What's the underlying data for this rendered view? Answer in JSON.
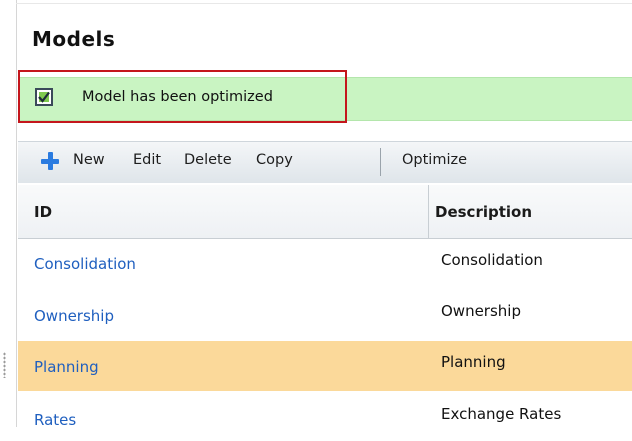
{
  "page_title": "Models",
  "notice": {
    "text": "Model has been optimized",
    "checked": true
  },
  "toolbar": {
    "new_label": "New",
    "edit_label": "Edit",
    "delete_label": "Delete",
    "copy_label": "Copy",
    "optimize_label": "Optimize"
  },
  "grid": {
    "columns": [
      "ID",
      "Description"
    ],
    "rows": [
      {
        "id": "Consolidation",
        "description": "Consolidation",
        "selected": false
      },
      {
        "id": "Ownership",
        "description": "Ownership",
        "selected": false
      },
      {
        "id": "Planning",
        "description": "Planning",
        "selected": true
      },
      {
        "id": "Rates",
        "description": "Exchange Rates",
        "selected": false
      }
    ]
  },
  "colors": {
    "notice_bg": "#c9f4c2",
    "callout_border": "#c4161c",
    "selected_row": "#fbd99a",
    "link": "#1f5fbf",
    "add_icon": "#2a7be0"
  }
}
